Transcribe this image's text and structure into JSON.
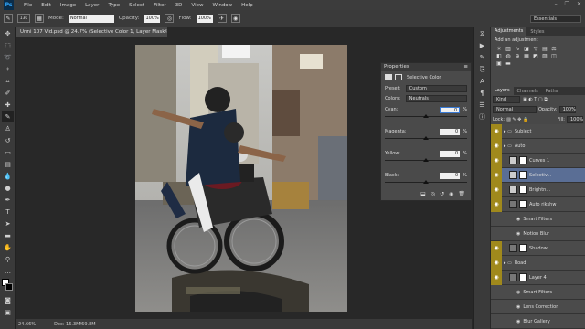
{
  "menubar": {
    "logo": "Ps",
    "items": [
      "File",
      "Edit",
      "Image",
      "Layer",
      "Type",
      "Select",
      "Filter",
      "3D",
      "View",
      "Window",
      "Help"
    ],
    "window_controls": [
      "–",
      "❐",
      "✕"
    ]
  },
  "options": {
    "brush_size": "130",
    "mode_label": "Mode:",
    "mode_value": "Normal",
    "opacity_label": "Opacity:",
    "opacity_value": "100%",
    "flow_label": "Flow:",
    "flow_value": "100%"
  },
  "workspace": "Essentials",
  "document": {
    "tab": "Unni 107 Vid.psd @ 24.7% (Selective Color 1, Layer Mask/8) *",
    "zoom": "24.66%",
    "doc_info": "Doc: 16.3M/69.8M"
  },
  "properties": {
    "tab": "Properties",
    "title": "Selective Color",
    "preset_label": "Preset:",
    "preset_value": "Custom",
    "colors_label": "Colors:",
    "colors_value": "Neutrals",
    "sliders": [
      {
        "label": "Cyan:",
        "value": "0",
        "unit": "%",
        "pos": 0.5
      },
      {
        "label": "Magenta:",
        "value": "0",
        "unit": "%",
        "pos": 0.5
      },
      {
        "label": "Yellow:",
        "value": "0",
        "unit": "%",
        "pos": 0.5
      },
      {
        "label": "Black:",
        "value": "0",
        "unit": "%",
        "pos": 0.5
      }
    ]
  },
  "adjustments": {
    "tabs": [
      "Adjustments",
      "Styles"
    ],
    "heading": "Add an adjustment"
  },
  "layers": {
    "tabs": [
      "Layers",
      "Channels",
      "Paths"
    ],
    "kind": "Kind",
    "blend": "Normal",
    "opacity_label": "Opacity:",
    "opacity_value": "100%",
    "lock_label": "Lock:",
    "fill_label": "Fill:",
    "fill_value": "100%",
    "rows": [
      {
        "name": "Subject",
        "type": "group",
        "color": "#4b4b4b"
      },
      {
        "name": "Auto",
        "type": "group",
        "color": "#4b4b4b"
      },
      {
        "name": "Curves 1",
        "type": "adj",
        "color": "#4b4b4b"
      },
      {
        "name": "Selectiv...",
        "type": "adj",
        "color": "#5a6e95"
      },
      {
        "name": "Brightn...",
        "type": "adj",
        "color": "#4b4b4b"
      },
      {
        "name": "Auto rikshw",
        "type": "layer",
        "color": "#4b4b4b"
      },
      {
        "name": "Smart Filters",
        "type": "sub",
        "color": "#4b4b4b"
      },
      {
        "name": "Motion Blur",
        "type": "sub",
        "color": "#4b4b4b"
      },
      {
        "name": "Shadow",
        "type": "layer",
        "color": "#4b4b4b"
      },
      {
        "name": "Road",
        "type": "group",
        "color": "#4b4b4b"
      },
      {
        "name": "Layer 4",
        "type": "layer",
        "color": "#4b4b4b"
      },
      {
        "name": "Smart Filters",
        "type": "sub",
        "color": "#4b4b4b"
      },
      {
        "name": "Lens Correction",
        "type": "sub",
        "color": "#4b4b4b"
      },
      {
        "name": "Blur Gallery",
        "type": "sub",
        "color": "#4b4b4b"
      }
    ]
  }
}
